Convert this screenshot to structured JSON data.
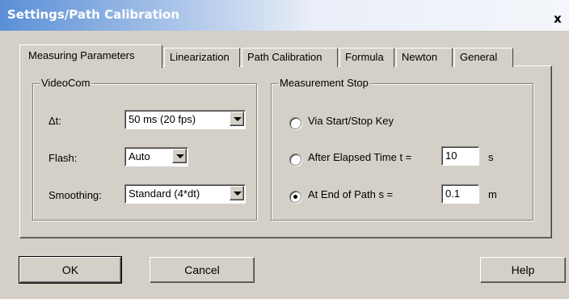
{
  "window": {
    "title": "Settings/Path Calibration",
    "close_glyph": "x"
  },
  "tabs": [
    {
      "label": "Measuring Parameters",
      "active": true
    },
    {
      "label": "Linearization"
    },
    {
      "label": "Path Calibration"
    },
    {
      "label": "Formula"
    },
    {
      "label": "Newton"
    },
    {
      "label": "General"
    }
  ],
  "videocom": {
    "title": "VideoCom",
    "at_label": "Δt:",
    "at_value": "50 ms (20 fps)",
    "flash_label": "Flash:",
    "flash_value": "Auto",
    "smoothing_label": "Smoothing:",
    "smoothing_value": "Standard (4*dt)"
  },
  "stop": {
    "title": "Measurement Stop",
    "options": [
      {
        "label": "Via Start/Stop Key",
        "checked": false
      },
      {
        "label": "After Elapsed Time t =",
        "checked": false,
        "value": "10",
        "unit": "s"
      },
      {
        "label": "At End of Path s =",
        "checked": true,
        "value": "0.1",
        "unit": "m"
      }
    ]
  },
  "buttons": {
    "ok": "OK",
    "cancel": "Cancel",
    "help": "Help"
  }
}
